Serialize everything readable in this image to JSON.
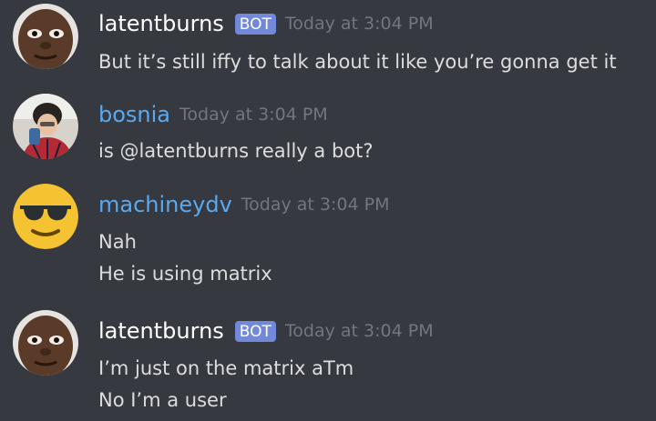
{
  "messages": [
    {
      "username": "latentburns",
      "bot_tag": "BOT",
      "timestamp": "Today at 3:04 PM",
      "lines": [
        "But it’s still iffy to talk about it like you’re gonna get it"
      ]
    },
    {
      "username": "bosnia",
      "timestamp": "Today at 3:04 PM",
      "lines": [
        "is @latentburns really a bot?"
      ]
    },
    {
      "username": "machineydv",
      "timestamp": "Today at 3:04 PM",
      "lines": [
        "Nah",
        "He is using matrix"
      ]
    },
    {
      "username": "latentburns",
      "bot_tag": "BOT",
      "timestamp": "Today at 3:04 PM",
      "lines": [
        "I’m just on the matrix aTm",
        "No I’m a user"
      ]
    }
  ],
  "colors": {
    "background": "#36393f",
    "username_default": "#ffffff",
    "username_blue": "#5aa9ef",
    "bot_tag": "#7289da",
    "timestamp": "#72767d",
    "message_text": "#dcddde"
  },
  "icons": {
    "latentburns_avatar": "face-photo-avatar",
    "bosnia_avatar": "person-photo-avatar",
    "machineydv_avatar": "sunglasses-emoji-avatar"
  }
}
